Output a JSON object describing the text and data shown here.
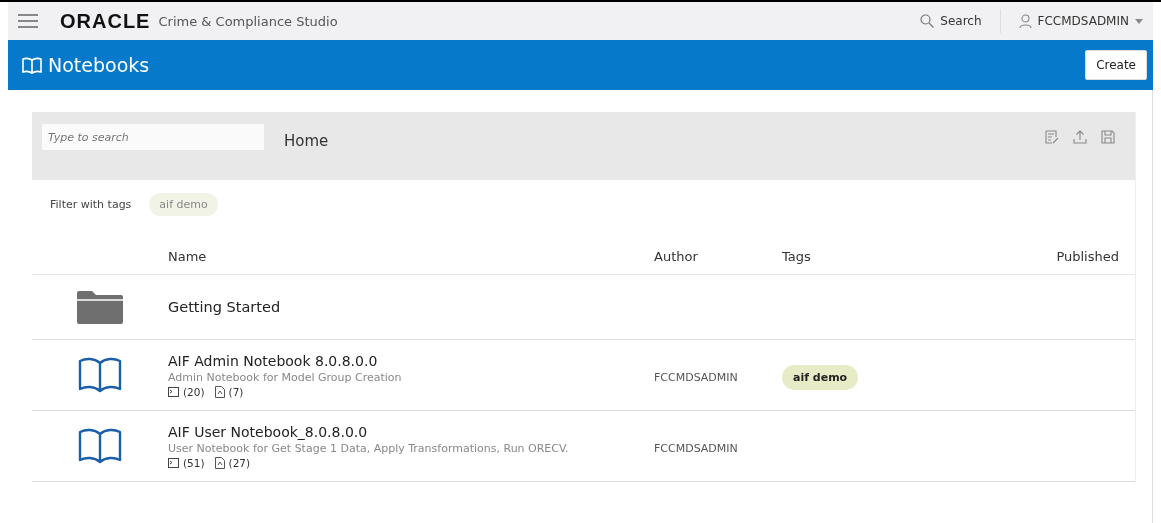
{
  "header": {
    "logo": "ORACLE",
    "product": "Crime & Compliance Studio",
    "search": "Search",
    "user": "FCCMDSADMIN"
  },
  "page": {
    "title": "Notebooks",
    "create_button": "Create"
  },
  "toolbar": {
    "search_placeholder": "Type to search",
    "breadcrumb": "Home"
  },
  "filter": {
    "label": "Filter with tags",
    "tags": [
      "aif demo"
    ]
  },
  "table": {
    "columns": [
      "Name",
      "Author",
      "Tags",
      "Published"
    ],
    "rows": [
      {
        "kind": "folder",
        "name": "Getting Started"
      },
      {
        "kind": "notebook",
        "name": "AIF Admin Notebook 8.0.8.0.0",
        "description": "Admin Notebook for Model Group Creation",
        "paragraphs": "(20)",
        "versions": "(7)",
        "author": "FCCMDSADMIN",
        "tags": [
          "aif demo"
        ]
      },
      {
        "kind": "notebook",
        "name": "AIF User Notebook_8.0.8.0.0",
        "description": "User Notebook for Get Stage 1 Data, Apply Transformations, Run ORECV.",
        "paragraphs": "(51)",
        "versions": "(27)",
        "author": "FCCMDSADMIN"
      }
    ]
  }
}
